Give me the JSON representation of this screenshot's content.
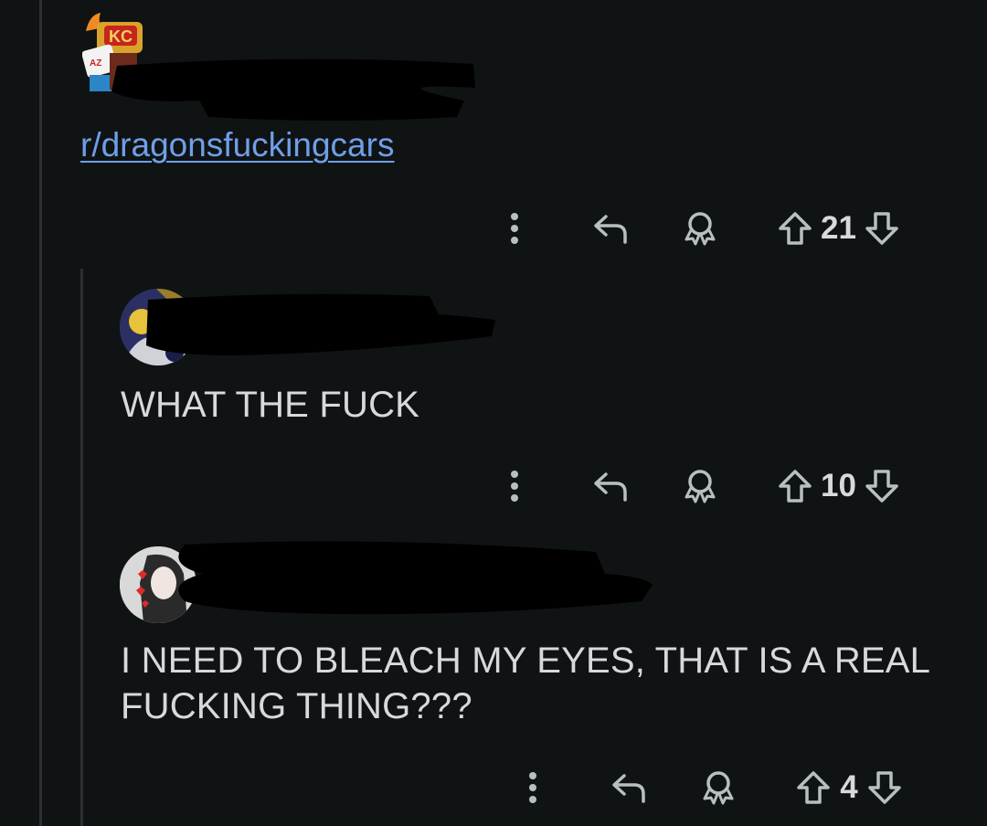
{
  "post": {
    "subreddit_link": "r/dragonsfuckingcars",
    "actions": {
      "score": "21",
      "icons": [
        "more-icon",
        "reply-icon",
        "award-icon",
        "upvote-icon",
        "downvote-icon"
      ]
    }
  },
  "comments": [
    {
      "body": "WHAT THE FUCK",
      "score": "10"
    },
    {
      "body_line1": "I NEED TO BLEACH MY EYES, THAT IS A REAL",
      "body_line2": "FUCKING THING???",
      "score": "4"
    }
  ],
  "colors": {
    "background": "#101314",
    "text": "#d7dadc",
    "link": "#6f9fe8",
    "icon": "#b9bec1",
    "thread_line": "#2b2f31"
  }
}
